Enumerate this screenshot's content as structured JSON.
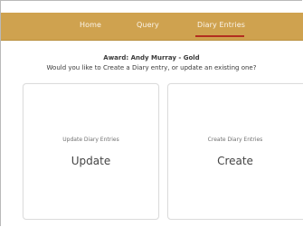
{
  "nav": {
    "items": [
      {
        "label": "Home"
      },
      {
        "label": "Query"
      },
      {
        "label": "Diary Entries"
      }
    ],
    "active_index": 2,
    "colors": {
      "background": "#cfa24f",
      "text": "#fbf5ea",
      "active_underline": "#b22d1f"
    }
  },
  "header": {
    "award": "Award: Andy Murray - Gold",
    "question": "Would you like to Create a Diary entry, or update an existing one?"
  },
  "cards": [
    {
      "subtitle": "Update Diary Entries",
      "title": "Update"
    },
    {
      "subtitle": "Create Diary Entries",
      "title": "Create"
    }
  ]
}
